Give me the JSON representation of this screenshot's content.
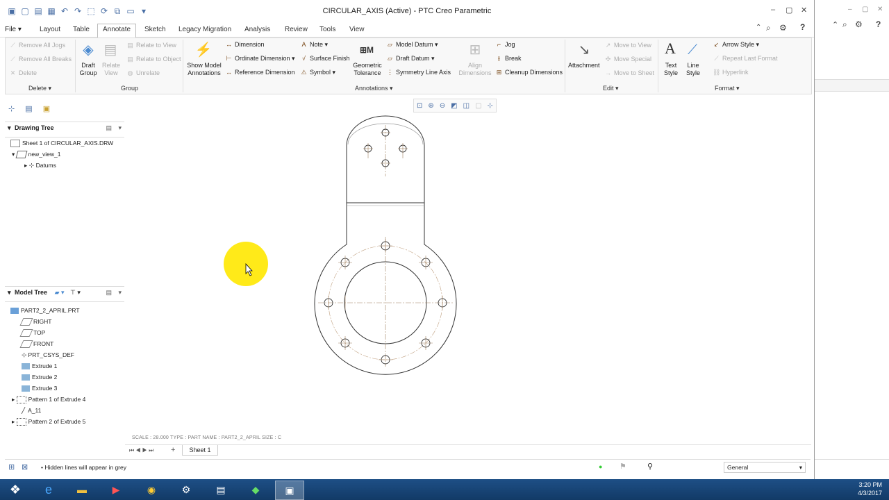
{
  "window": {
    "title": "CIRCULAR_AXIS (Active) - PTC Creo Parametric"
  },
  "menu": {
    "file": "File",
    "tabs": [
      "Layout",
      "Table",
      "Annotate",
      "Sketch",
      "Legacy Migration",
      "Analysis",
      "Review",
      "Tools",
      "View"
    ],
    "active_tab": "Annotate"
  },
  "ribbon": {
    "delete_group": {
      "label": "Delete",
      "items": [
        "Remove All Jogs",
        "Remove All Breaks",
        "Delete"
      ]
    },
    "group_group": {
      "label": "Group",
      "draft_group": "Draft Group",
      "relate_view": "Relate View",
      "items": [
        "Relate to View",
        "Relate to Object",
        "Unrelate"
      ]
    },
    "annotations_group": {
      "label": "Annotations",
      "show_model": "Show Model Annotations",
      "col1": [
        "Dimension",
        "Ordinate Dimension",
        "Reference Dimension"
      ],
      "col2": [
        "Note",
        "Surface Finish",
        "Symbol"
      ],
      "geom_tol": "Geometric Tolerance",
      "col3": [
        "Model Datum",
        "Draft Datum",
        "Symmetry Line Axis"
      ],
      "align_dims": "Align Dimensions",
      "col4": [
        "Jog",
        "Break",
        "Cleanup Dimensions"
      ]
    },
    "edit_group": {
      "label": "Edit",
      "attachment": "Attachment",
      "items": [
        "Move to View",
        "Move Special",
        "Move to Sheet"
      ]
    },
    "format_group": {
      "label": "Format",
      "text_style": "Text Style",
      "line_style": "Line Style",
      "items": [
        "Arrow Style",
        "Repeat Last Format",
        "Hyperlink"
      ]
    }
  },
  "drawing_tree": {
    "title": "Drawing Tree",
    "items": [
      "Sheet 1 of CIRCULAR_AXIS.DRW",
      "new_view_1",
      "Datums"
    ]
  },
  "model_tree": {
    "title": "Model Tree",
    "items": [
      "PART2_2_APRIL.PRT",
      "RIGHT",
      "TOP",
      "FRONT",
      "PRT_CSYS_DEF",
      "Extrude 1",
      "Extrude 2",
      "Extrude 3",
      "Pattern 1 of Extrude 4",
      "A_11",
      "Pattern 2 of Extrude 5"
    ]
  },
  "canvas": {
    "info": "SCALE : 28.000     TYPE : PART     NAME : PART2_2_APRIL     SIZE : C"
  },
  "sheets": {
    "active": "Sheet 1"
  },
  "status": {
    "message": "Hidden lines will appear in grey",
    "filter": "General"
  },
  "taskbar": {
    "time": "3:20 PM",
    "date": "4/3/2017"
  },
  "colors": {
    "accent": "#2a5a9a",
    "taskbar": "#1a4478",
    "cursor_highlight": "#ffe800"
  }
}
